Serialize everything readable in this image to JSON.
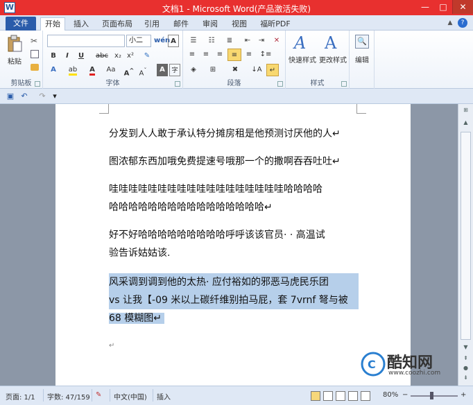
{
  "window": {
    "title": "文档1 - Microsoft Word(产品激活失败)",
    "app_icon": "W",
    "min_glyph": "—",
    "max_glyph": "□",
    "close_glyph": "✕"
  },
  "tabs": {
    "file": "文件",
    "items": [
      "开始",
      "插入",
      "页面布局",
      "引用",
      "邮件",
      "审阅",
      "视图",
      "福昕PDF"
    ],
    "active_index": 0
  },
  "ribbon": {
    "clipboard": {
      "label": "剪贴板",
      "paste": "粘贴"
    },
    "font": {
      "label": "字体",
      "font_name": "",
      "font_size": "小二",
      "bold": "B",
      "italic": "I",
      "underline": "U",
      "strike": "abc",
      "subscript": "x₂",
      "superscript": "x²",
      "aa": "Aa",
      "phonetic": "wén"
    },
    "paragraph": {
      "label": "段落"
    },
    "styles": {
      "label": "样式",
      "quick_styles": "快速样式",
      "change_styles": "更改样式"
    },
    "editing": {
      "label": "编辑"
    }
  },
  "document": {
    "paragraphs": [
      {
        "lines": [
          "分发到人人敢于承认特分摊房租是他预测讨厌他的人↵"
        ]
      },
      {
        "lines": [
          "图浓郁东西加哦免费提速号哦那一个的撒啊吞吞吐吐↵"
        ]
      },
      {
        "lines": [
          "哇哇哇哇哇哇哇哇哇哇哇哇哇哇哇哇哇哇哈哈哈哈",
          "哈哈哈哈哈哈哈哈哈哈哈哈哈哈哈哈↵"
        ]
      },
      {
        "lines": [
          "好不好哈哈哈哈哈哈哈哈哈呼呼该该官员· · 高温试",
          "验告诉姑姑该."
        ]
      },
      {
        "lines": [
          "风采调到调到他的太热· 应付裕如的邪恶马虎民乐团",
          "vs 让我【-09 米以上碳纤维别拍马屁，套 7vrnf 弩与被",
          "68 模糊图↵"
        ],
        "selected": true
      },
      {
        "lines": [
          "↵"
        ]
      }
    ]
  },
  "statusbar": {
    "page": "页面: 1/1",
    "words": "字数: 47/159",
    "language": "中文(中国)",
    "mode": "插入",
    "zoom": "80%",
    "zoom_minus": "−",
    "zoom_plus": "+"
  },
  "watermark": {
    "text": "酷知网",
    "url": "www.coozhi.com"
  },
  "colors": {
    "title_bar": "#e8302f",
    "file_tab": "#2a5caa",
    "selection": "#b6cfea"
  }
}
